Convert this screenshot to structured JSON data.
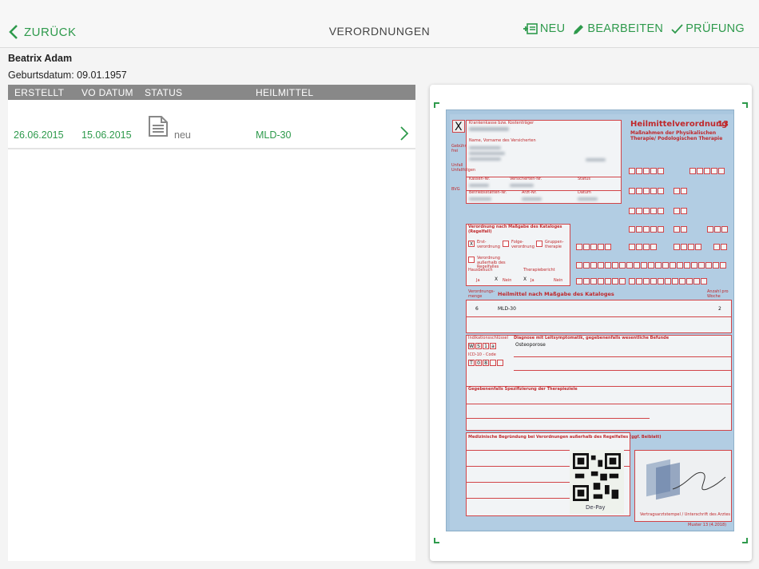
{
  "header": {
    "back_label": "ZURÜCK",
    "title": "VERORDNUNGEN",
    "new_label": "NEU",
    "edit_label": "BEARBEITEN",
    "check_label": "PRÜFUNG"
  },
  "patient": {
    "name": "Beatrix Adam",
    "dob": "Geburtsdatum: 09.01.1957"
  },
  "table": {
    "columns": [
      "ERSTELLT",
      "VO DATUM",
      "STATUS",
      "HEILMITTEL"
    ],
    "rows": [
      {
        "created": "26.06.2015",
        "vo_date": "15.06.2015",
        "status": "neu",
        "remedy": "MLD-30"
      }
    ]
  },
  "form": {
    "box_x": "X",
    "insurer_label": "Krankenkasse bzw. Kostenträger",
    "name_label": "Name, Vorname des Versicherten",
    "title": "Heilmittelverordnung",
    "number": "13",
    "subtitle": "Maßnahmen der Physikalischen Therapie/ Podologischen Therapie",
    "side_labels": [
      "Gebühr frei",
      "Unfall Unfallfolgen",
      "BVG"
    ],
    "kassen_nr_label": "Kassen-Nr.",
    "versicherten_nr_label": "Versicherten-Nr.",
    "status_label": "Status",
    "betriebsstaetten_label": "Betriebsstätten-Nr.",
    "arzt_nr_label": "Arzt-Nr.",
    "datum_label": "Datum",
    "katalog_label": "Verordnung nach Maßgabe des Kataloges (Regelfall)",
    "erst_label": "Erst-verordnung",
    "folge_label": "Folge-verordnung",
    "gruppe_label": "Gruppen-therapie",
    "ausserhalb_label": "Verordnung außerhalb des Regelfalles",
    "hausbesuch_label": "Hausbesuch",
    "therapiebericht_label": "Therapiebericht",
    "ja_label": "Ja",
    "nein_label": "Nein",
    "heilmittel_header": "Heilmittel nach Maßgabe des Kataloges",
    "menge_label": "Verordnungs-menge",
    "anzahl_label": "Anzahl pro Woche",
    "menge": "6",
    "heilmittel": "MLD-30",
    "anzahl": "2",
    "indikation_label": "Indikationsschlüssel",
    "indikation_codes": [
      "W",
      "S",
      "1",
      "a"
    ],
    "diagnose_label": "Diagnose mit Leitsymptomatik, gegebenenfalls wesentliche Befunde",
    "diagnose": "Osteoporose",
    "icd_label": "ICD-10 - Code",
    "icd_codes": [
      "T",
      "0",
      "8"
    ],
    "spezifizierung_label": "Gegebenenfalls Spezifizierung der Therapieziele",
    "begruendung_label": "Medizinische Begründung bei Verordnungen außerhalb des Regelfalles (ggf. Beiblatt)",
    "stempel_label": "Vertragsarztstempel / Unterschrift des Arztes",
    "muster_label": "Muster 13 (4.2018)",
    "depay_label": "De-Pay"
  },
  "colors": {
    "accent": "#2e9a4c",
    "form_red": "#c0282b",
    "form_blue": "#b2cde3"
  },
  "icons": [
    "chevron-left-icon",
    "new-document-icon",
    "pencil-icon",
    "check-icon",
    "document-icon",
    "chevron-right-icon",
    "qr-code-icon"
  ]
}
